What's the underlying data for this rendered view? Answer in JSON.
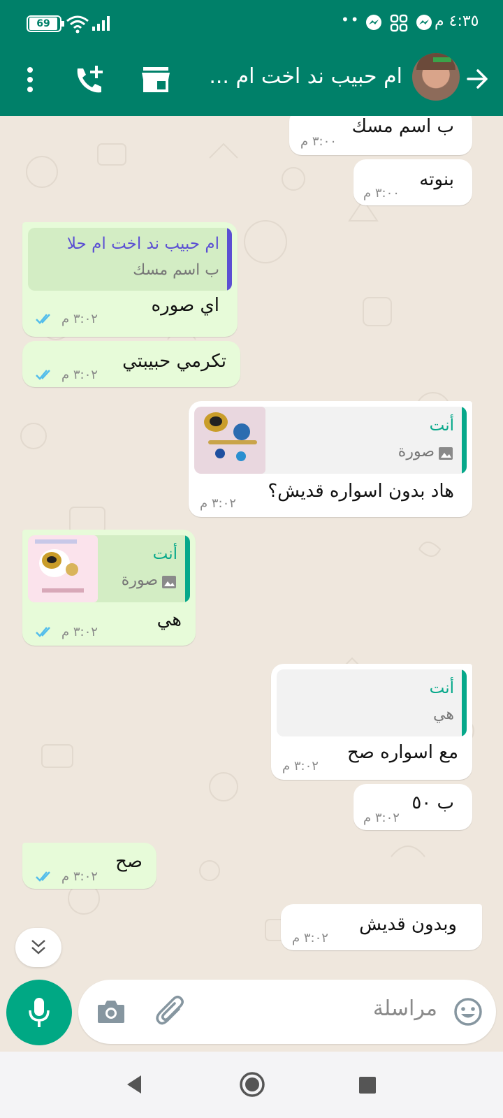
{
  "status_bar": {
    "time": "٤:٣٥ م",
    "dots": "••",
    "battery": "69"
  },
  "header": {
    "contact_name": "ام حبيب ند اخت ام ...",
    "icons": [
      "back-arrow-icon",
      "avatar",
      "store-icon",
      "add-call-icon",
      "more-vert-icon"
    ]
  },
  "messages": [
    {
      "id": 1,
      "dir": "in",
      "text": "ب اسم مسك",
      "time": "٣:٠٠ م"
    },
    {
      "id": 2,
      "dir": "in",
      "text": "بنوته",
      "time": "٣:٠٠ م"
    },
    {
      "id": 3,
      "dir": "out",
      "quote_name": "ام حبيب ند اخت ام حلا",
      "quote_text": "ب اسم مسك",
      "text": "اي صوره",
      "time": "٣:٠٢ م",
      "status": "read"
    },
    {
      "id": 4,
      "dir": "out",
      "text": "تكرمي حبيبتي",
      "time": "٣:٠٢ م",
      "status": "read"
    },
    {
      "id": 5,
      "dir": "in",
      "quote_name": "أنت",
      "quote_text": "صورة",
      "text": "هاد بدون اسواره قديش؟",
      "time": "٣:٠٢ م"
    },
    {
      "id": 6,
      "dir": "out",
      "quote_name": "أنت",
      "quote_text": "صورة",
      "text": "هي",
      "time": "٣:٠٢ م",
      "status": "read"
    },
    {
      "id": 7,
      "dir": "in",
      "quote_name": "أنت",
      "quote_text": "هي",
      "text": "مع اسواره صح",
      "time": "٣:٠٢ م"
    },
    {
      "id": 8,
      "dir": "in",
      "text": "ب ٥٠",
      "time": "٣:٠٢ م"
    },
    {
      "id": 9,
      "dir": "out",
      "text": "صح",
      "time": "٣:٠٢ م",
      "status": "read"
    },
    {
      "id": 10,
      "dir": "in",
      "text": "وبدون قديش",
      "time": "٣:٠٢ م"
    }
  ],
  "composer": {
    "placeholder": "مراسلة"
  },
  "colors": {
    "brand": "#008069",
    "outgoing_bubble": "#e7fbd9",
    "incoming_bubble": "#ffffff",
    "mic_button": "#00a884",
    "quote_other": "#5b4fd3",
    "quote_you": "#06a88a",
    "read_ticks": "#53bdeb"
  }
}
